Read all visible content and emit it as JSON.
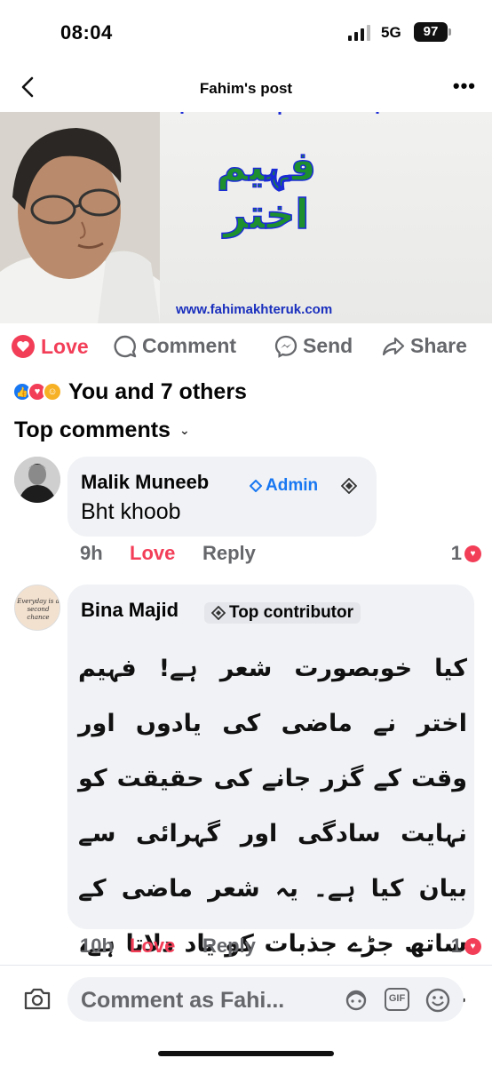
{
  "status": {
    "time": "08:04",
    "network": "5G",
    "battery": "97"
  },
  "nav": {
    "title": "Fahim's post"
  },
  "post": {
    "image_title": "فہیم اختر",
    "website": "www.fahimakhteruk.com"
  },
  "actions": {
    "love": "Love",
    "comment": "Comment",
    "send": "Send",
    "share": "Share"
  },
  "reactions": {
    "summary": "You and 7 others"
  },
  "top_comments_label": "Top comments",
  "comments": [
    {
      "author": "Malik Muneeb",
      "badge": "Admin",
      "text": "Bht khoob",
      "time": "9h",
      "love": "Love",
      "reply": "Reply",
      "reaction_count": "1"
    },
    {
      "author": "Bina Majid",
      "badge": "Top contributor",
      "avatar_text": "Everyday is a second chance",
      "text": "کیا خوبصورت شعر ہے! فہیم اختر نے ماضی کی یادوں اور وقت کے گزر جانے کی حقیقت کو نہایت سادگی اور گہرائی سے بیان کیا ہے۔ یہ شعر ماضی کے ساتھ جڑے جذبات کو یاد دلاتا ہے، جو دل کو چھو جانے والا ہے۔",
      "time": "10h",
      "love": "Love",
      "reply": "Reply",
      "reaction_count": "1"
    }
  ],
  "composer": {
    "placeholder": "Comment as Fahi...",
    "gif": "GIF"
  },
  "icons": [
    "back-icon",
    "more-icon",
    "heart-icon",
    "comment-icon",
    "messenger-icon",
    "share-icon",
    "camera-icon",
    "avatar-sticker-icon",
    "gif-icon",
    "emoji-icon",
    "diamond-badge-icon"
  ],
  "colors": {
    "love": "#f33e58",
    "facebook_blue": "#1877f2",
    "muted": "#65676b",
    "bubble": "#f0f2f5"
  }
}
